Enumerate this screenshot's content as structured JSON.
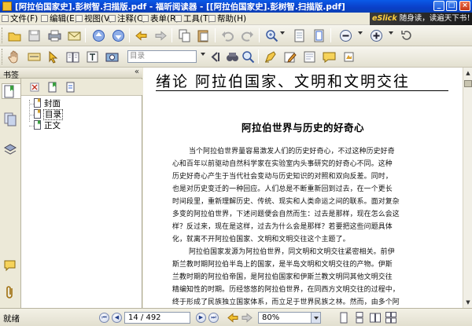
{
  "window": {
    "title": "[阿拉伯国家史].彭树智.扫描版.pdf - 福昕阅读器 - [[阿拉伯国家史].彭树智.扫描版.pdf]",
    "controls": [
      "_",
      "□",
      "×"
    ]
  },
  "menu": {
    "items": [
      "文件(F)",
      "编辑(E)",
      "视图(V)",
      "注释(C)",
      "表单(R)",
      "工具(T)",
      "帮助(H)"
    ],
    "banner_brand": "eSlick",
    "banner_text": "随身读，读遍天下书！"
  },
  "toolbar": {
    "page_select_placeholder": "目录",
    "accent_color": "#0a5ae8"
  },
  "left_panel": {
    "title": "书签",
    "collapse_glyph": "«",
    "bookmarks": [
      {
        "label": "封面",
        "selected": false
      },
      {
        "label": "目录",
        "selected": true
      },
      {
        "label": "正文",
        "selected": false
      }
    ]
  },
  "document": {
    "chapter_title": "绪论  阿拉伯国家、文明和文明交往",
    "section_title": "阿拉伯世界与历史的好奇心",
    "body_lines": [
      "当个阿拉伯世界量容易激发人们的历史好奇心，不过这种历史好奇",
      "心和百年以前驱动自然科学家在实验室内头事研究的好奇心不同。这种",
      "历史好奇心产生于当代社会变动与历史知识的对照和双向反差。同时，",
      "也是对历史变迁的一种回应。人们总是不断重新回到过去，在一个更长",
      "时间段里，重新理解历史、传统、现实和人类命运之间的联系。面对复杂",
      "多变的阿拉伯世界，下述问题便会自然而生：过去是那样，现在怎么会这",
      "样？反过来，现在是这样，过去为什么会是那样？若要把这些问题具体",
      "化，就离不开阿拉伯国家、文明和文明交往这个主题了。",
      "阿拉伯国家发源为阿拉伯世界，同文明和文明交往紧密相关。前伊",
      "斯兰教时期阿拉伯半岛上的国家，是半岛文明和文明交往的产物。伊斯",
      "兰教时期的阿拉伯帝国，是阿拉伯国家和伊斯兰教文明同其他文明交往",
      "精编知性的时期。历经悠悠的阿拉伯世界，在同西方文明交往的过程中，",
      "终于形成了民族独立国家体系，而立足于世界民族之林。然而，由多个阿"
    ]
  },
  "status": {
    "ready_text": "就绪",
    "page_indicator": "14 / 492",
    "zoom": "80%"
  }
}
